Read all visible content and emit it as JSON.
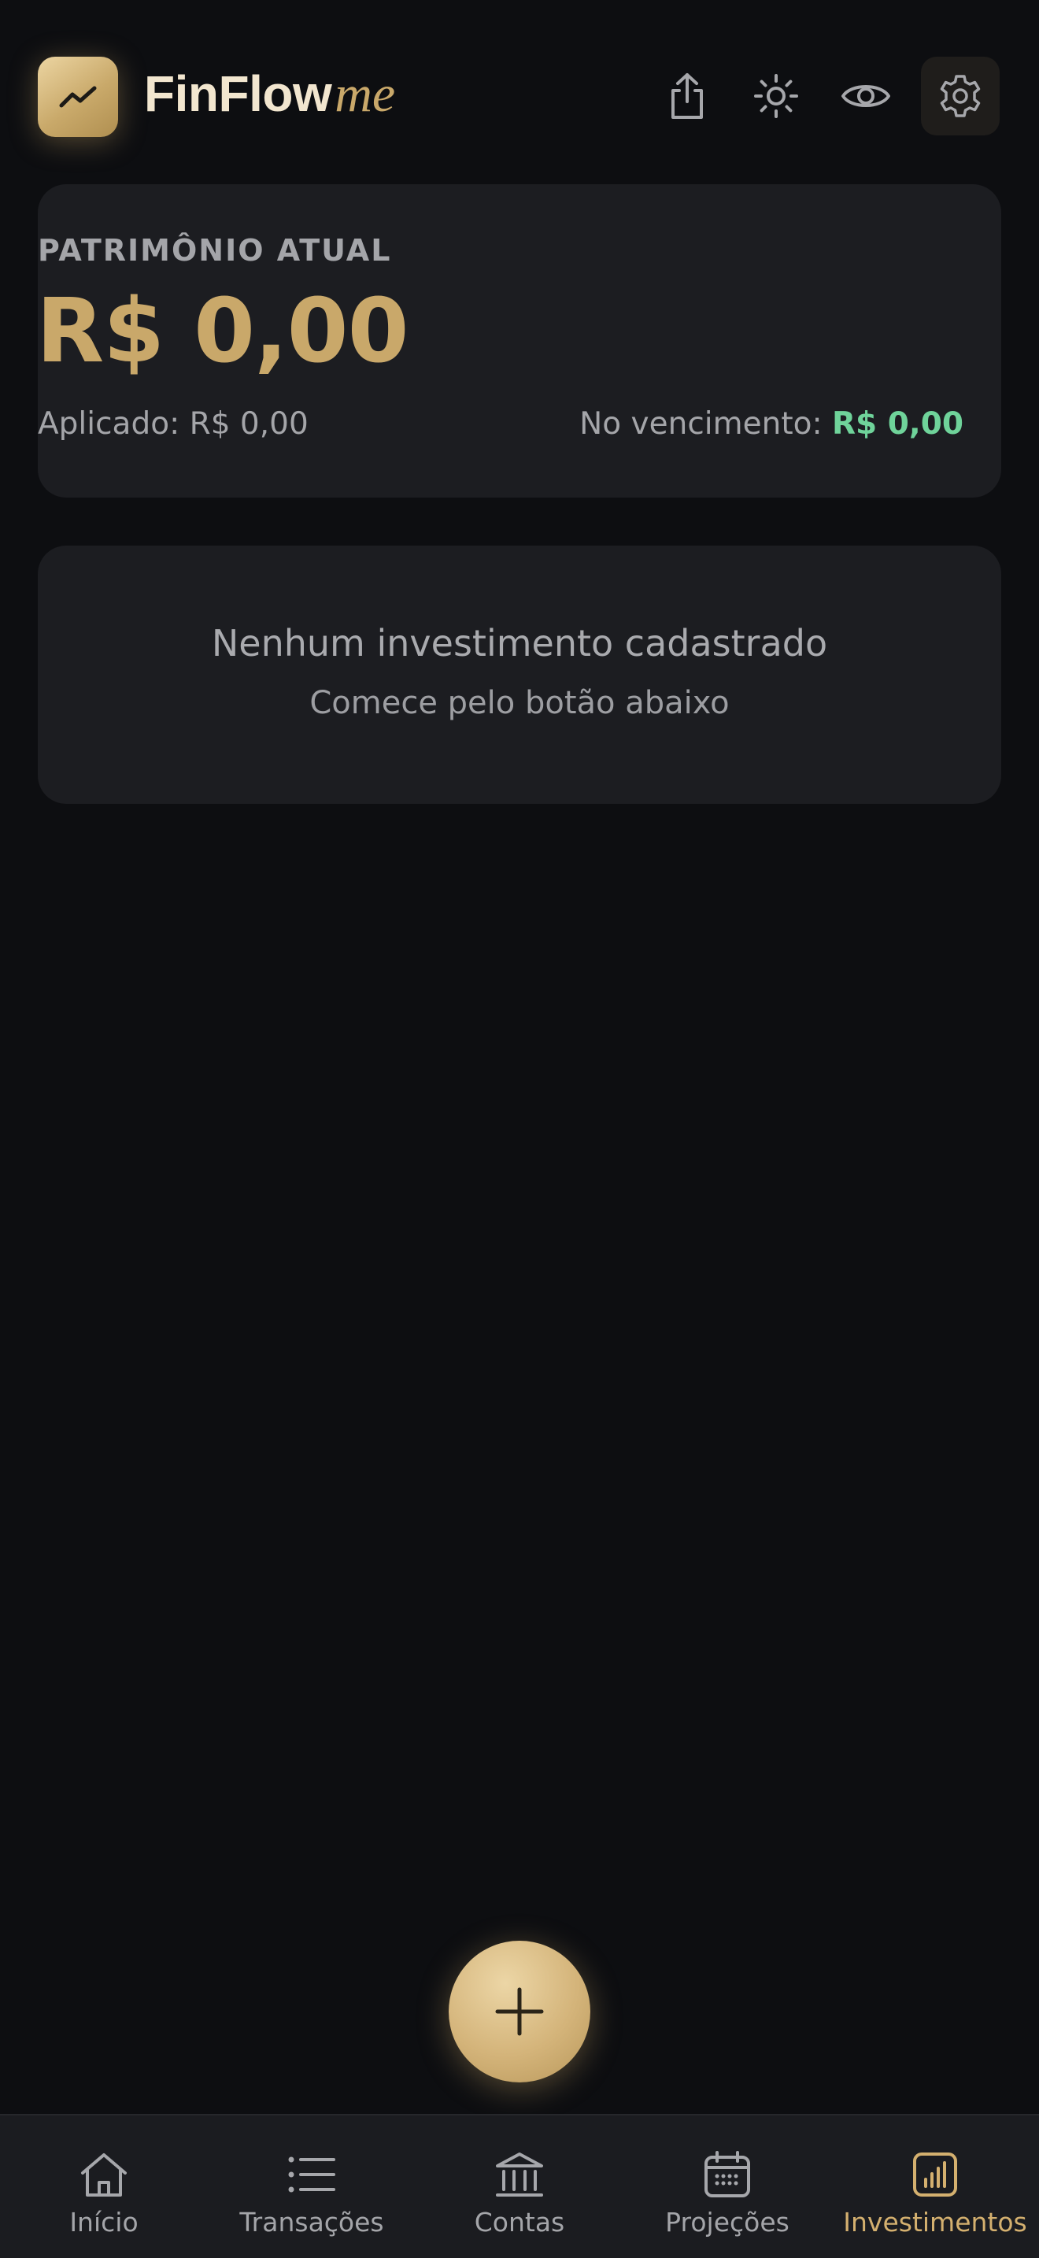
{
  "header": {
    "brand_main": "FinFlow",
    "brand_accent": "me",
    "icons": [
      "trend-up-icon",
      "share-icon",
      "sun-icon",
      "eye-icon",
      "gear-icon"
    ]
  },
  "summary": {
    "label": "PATRIMÔNIO ATUAL",
    "value": "R$ 0,00",
    "applied_label": "Aplicado:",
    "applied_value": "R$ 0,00",
    "maturity_label": "No vencimento:",
    "maturity_value": "R$ 0,00"
  },
  "empty_state": {
    "title": "Nenhum investimento cadastrado",
    "subtitle": "Comece pelo botão abaixo"
  },
  "fab": {
    "icon": "plus-icon"
  },
  "nav": {
    "items": [
      {
        "label": "Início",
        "icon": "home-icon",
        "active": false
      },
      {
        "label": "Transações",
        "icon": "list-icon",
        "active": false
      },
      {
        "label": "Contas",
        "icon": "bank-icon",
        "active": false
      },
      {
        "label": "Projeções",
        "icon": "calendar-icon",
        "active": false
      },
      {
        "label": "Investimentos",
        "icon": "bar-chart-icon",
        "active": true
      }
    ]
  },
  "colors": {
    "background": "#0d0e11",
    "card": "#1c1d21",
    "gold": "#c9a86a",
    "green": "#6fd39a",
    "muted": "#a4a5a9"
  }
}
